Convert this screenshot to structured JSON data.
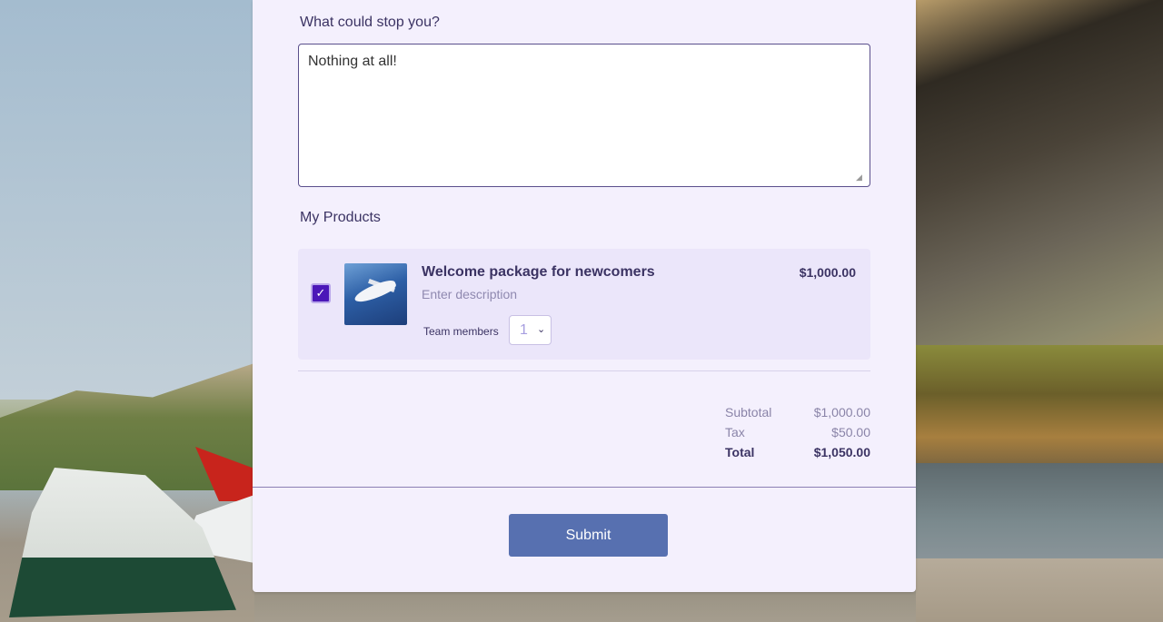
{
  "form": {
    "question_label": "What could stop you?",
    "answer_value": "Nothing at all!",
    "products_label": "My Products",
    "submit_label": "Submit"
  },
  "product": {
    "checked": true,
    "title": "Welcome package for newcomers",
    "description_placeholder": "Enter description",
    "price": "$1,000.00",
    "team_label": "Team members",
    "team_value": "1"
  },
  "totals": {
    "subtotal_label": "Subtotal",
    "subtotal_value": "$1,000.00",
    "tax_label": "Tax",
    "tax_value": "$50.00",
    "total_label": "Total",
    "total_value": "$1,050.00"
  },
  "colors": {
    "panel_bg": "#f4f0fd",
    "accent": "#4b17b8",
    "submit_bg": "#5770b0",
    "text_primary": "#3b3363"
  },
  "icons": {
    "checkbox": "check-icon",
    "select": "chevron-down-icon",
    "product_image": "airplane-image"
  }
}
